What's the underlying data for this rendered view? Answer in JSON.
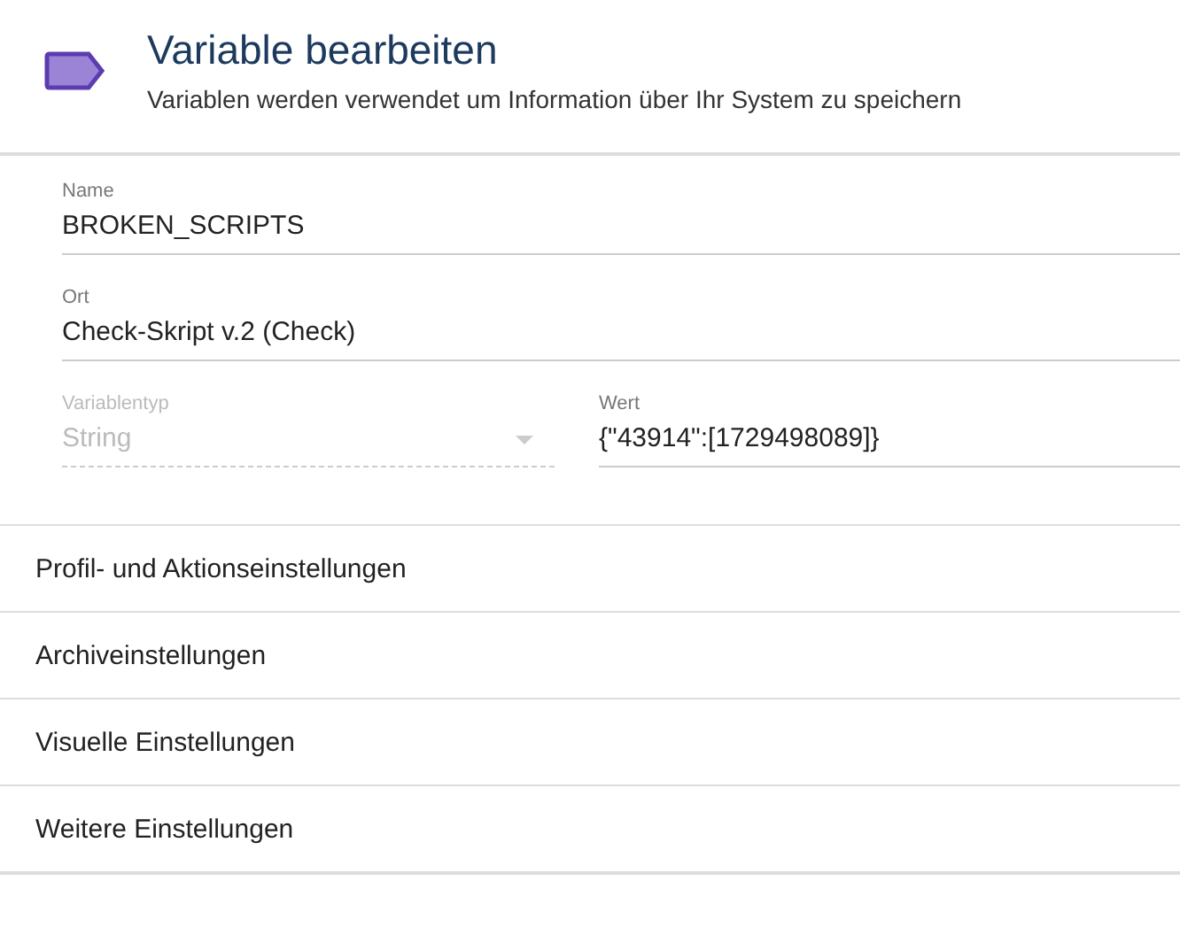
{
  "header": {
    "title": "Variable bearbeiten",
    "subtitle": "Variablen werden verwendet um Information über Ihr System zu speichern"
  },
  "fields": [
    {
      "kind": "text",
      "label": "Name",
      "value": "BROKEN_SCRIPTS",
      "disabled": false
    },
    {
      "kind": "text",
      "label": "Ort",
      "value": "Check-Skript v.2 (Check)",
      "disabled": false
    }
  ],
  "row_fields": [
    {
      "kind": "select",
      "label": "Variablentyp",
      "value": "String",
      "disabled": true
    },
    {
      "kind": "text",
      "label": "Wert",
      "value": "{\"43914\":[1729498089]}",
      "disabled": false
    }
  ],
  "sections": [
    {
      "label": "Profil- und Aktionseinstellungen"
    },
    {
      "label": "Archiveinstellungen"
    },
    {
      "label": "Visuelle Einstellungen"
    },
    {
      "label": "Weitere Einstellungen"
    }
  ]
}
